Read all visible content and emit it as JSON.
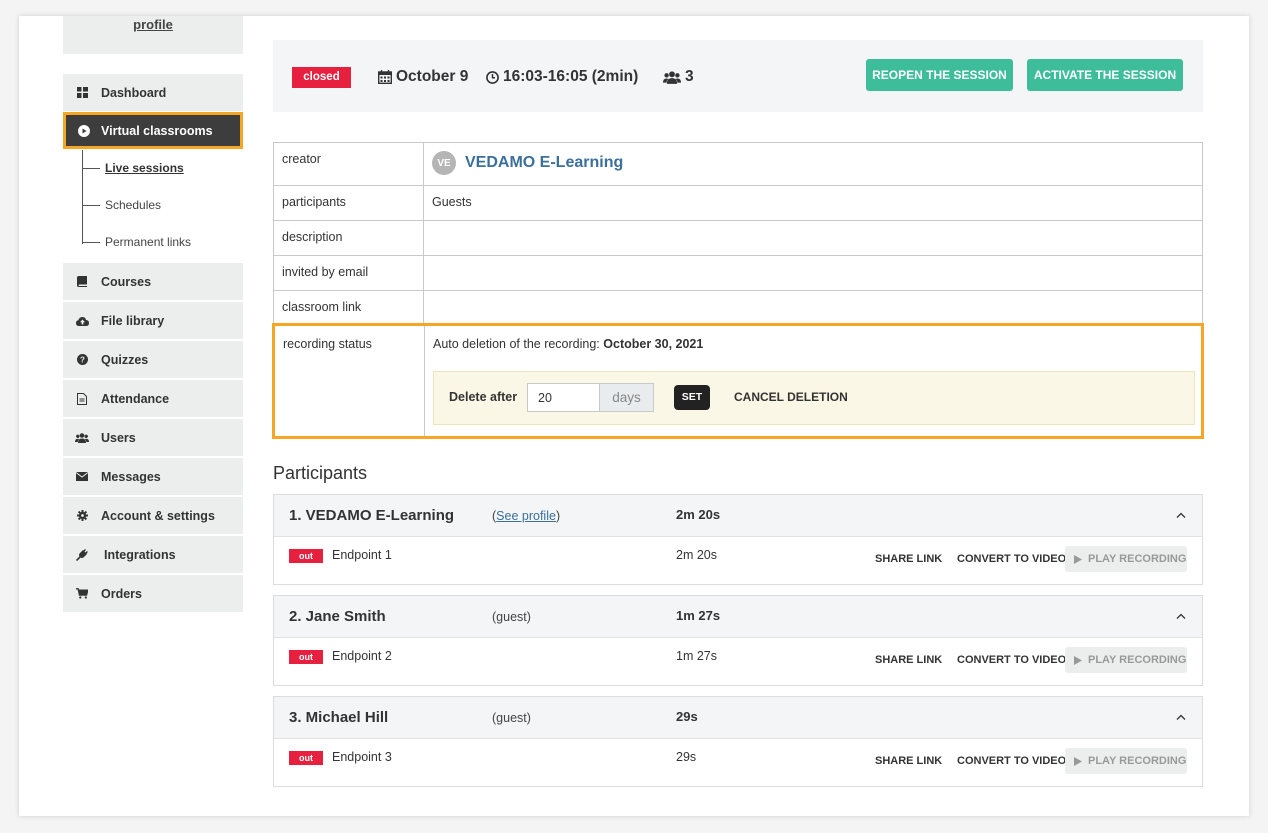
{
  "sidebar": {
    "profile_link": "profile",
    "items": [
      {
        "label": "Dashboard",
        "icon": "dashboard-icon"
      },
      {
        "label": "Virtual classrooms",
        "icon": "play-circle-icon"
      },
      {
        "label": "Courses",
        "icon": "book-icon"
      },
      {
        "label": "File library",
        "icon": "cloud-upload-icon"
      },
      {
        "label": "Quizzes",
        "icon": "question-circle-icon"
      },
      {
        "label": "Attendance",
        "icon": "document-icon"
      },
      {
        "label": "Users",
        "icon": "users-icon"
      },
      {
        "label": "Messages",
        "icon": "envelope-icon"
      },
      {
        "label": "Account & settings",
        "icon": "gear-icon"
      },
      {
        "label": "Integrations",
        "icon": "plug-icon"
      },
      {
        "label": "Orders",
        "icon": "cart-icon"
      }
    ],
    "subitems": [
      "Live sessions",
      "Schedules",
      "Permanent links"
    ]
  },
  "session": {
    "status": "closed",
    "date": "October 9",
    "time": "16:03-16:05 (2min)",
    "participants_count": "3",
    "reopen_label": "REOPEN THE SESSION",
    "activate_label": "ACTIVATE THE SESSION"
  },
  "details": {
    "creator_label": "creator",
    "creator_initials": "VE",
    "creator_name": "VEDAMO E-Learning",
    "participants_label": "participants",
    "participants_value": "Guests",
    "description_label": "description",
    "invited_label": "invited by email",
    "classroom_link_label": "classroom link",
    "recording_label": "recording status",
    "auto_deletion_text": "Auto deletion of the recording:",
    "auto_deletion_date": "October 30, 2021",
    "delete_after_label": "Delete after",
    "delete_after_value": "20",
    "days_label": "days",
    "set_label": "SET",
    "cancel_label": "CANCEL DELETION"
  },
  "participants": {
    "title": "Participants",
    "share_label": "SHARE LINK",
    "convert_label": "CONVERT TO VIDEO",
    "play_label": "PLAY RECORDING",
    "out_label": "out",
    "list": [
      {
        "name": "1. VEDAMO E-Learning",
        "role_prefix": "(",
        "role_link": "See profile",
        "role_suffix": ")",
        "total": "2m 20s",
        "endpoint": "Endpoint 1",
        "endpoint_time": "2m 20s"
      },
      {
        "name": "2. Jane Smith",
        "role": "(guest)",
        "total": "1m 27s",
        "endpoint": "Endpoint 2",
        "endpoint_time": "1m 27s"
      },
      {
        "name": "3. Michael Hill",
        "role": "(guest)",
        "total": "29s",
        "endpoint": "Endpoint 3",
        "endpoint_time": "29s"
      }
    ]
  },
  "colors": {
    "accent_green": "#3dbd9a",
    "danger_red": "#e8203f",
    "highlight_orange": "#f5a623",
    "link_blue": "#3b6f9c"
  }
}
